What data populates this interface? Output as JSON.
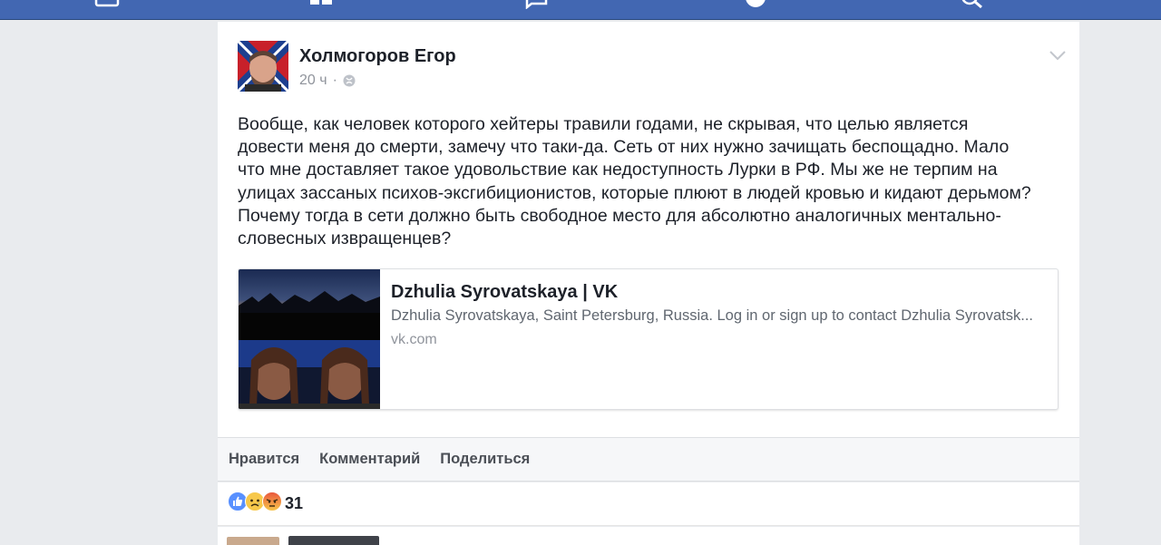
{
  "topbar": {
    "color": "#4267b2",
    "icons": [
      "home-icon",
      "feed-icon",
      "messages-icon",
      "globe-icon",
      "search-icon"
    ]
  },
  "post": {
    "author": "Холмогоров Егор",
    "timestamp": "20 ч",
    "separator": "·",
    "privacy_icon": "globe-icon",
    "text": "Вообще, как человек которого хейтеры травили годами, не скрывая, что целью является\nдовести меня до смерти, замечу что таки-да. Сеть от них нужно зачищать беспощадно. Мало\nчто мне доставляет такое удовольствие как недоступность Лурки в РФ. Мы же не терпим на\nулицах зассаных психов-эксгибиционистов, которые плюют в людей кровью и кидают дерьмом?\nПочему тогда в сети должно быть свободное место для абсолютно аналогичных ментально-\nсловесных извращенцев?",
    "link": {
      "title": "Dzhulia Syrovatskaya | VK",
      "description": "Dzhulia Syrovatskaya, Saint Petersburg, Russia. Log in or sign up to contact Dzhulia Syrovatsk...",
      "domain": "vk.com"
    }
  },
  "actions": {
    "like": "Нравится",
    "comment": "Комментарий",
    "share": "Поделиться"
  },
  "reactions": {
    "icons": [
      "like-reaction-icon",
      "sad-reaction-icon",
      "angry-reaction-icon"
    ],
    "count": "31"
  }
}
